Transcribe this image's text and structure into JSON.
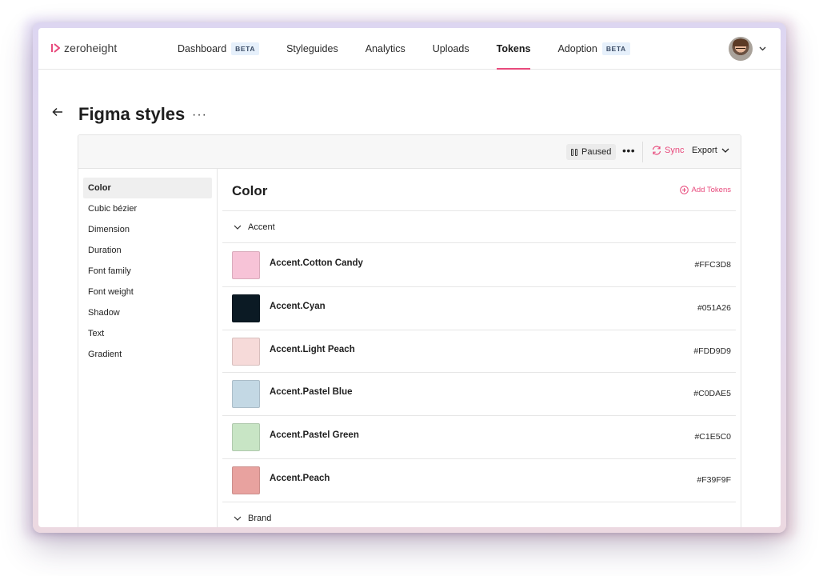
{
  "app": {
    "logo_text": "zeroheight",
    "brand_color": "#e84a7c"
  },
  "nav": {
    "items": [
      {
        "label": "Dashboard",
        "badge": "BETA",
        "active": false
      },
      {
        "label": "Styleguides",
        "badge": "",
        "active": false
      },
      {
        "label": "Analytics",
        "badge": "",
        "active": false
      },
      {
        "label": "Uploads",
        "badge": "",
        "active": false
      },
      {
        "label": "Tokens",
        "badge": "",
        "active": true
      },
      {
        "label": "Adoption",
        "badge": "BETA",
        "active": false
      }
    ],
    "avatar_icon": "user-avatar",
    "avatar_menu_icon": "chevron-down-icon"
  },
  "page": {
    "title": "Figma styles",
    "title_more": "···"
  },
  "toolbar": {
    "paused_label": "Paused",
    "more_label": "•••",
    "sync_label": "Sync",
    "export_label": "Export"
  },
  "sidebar": {
    "items": [
      {
        "label": "Color",
        "active": true
      },
      {
        "label": "Cubic bézier",
        "active": false
      },
      {
        "label": "Dimension",
        "active": false
      },
      {
        "label": "Duration",
        "active": false
      },
      {
        "label": "Font family",
        "active": false
      },
      {
        "label": "Font weight",
        "active": false
      },
      {
        "label": "Shadow",
        "active": false
      },
      {
        "label": "Text",
        "active": false
      },
      {
        "label": "Gradient",
        "active": false
      }
    ]
  },
  "main": {
    "title": "Color",
    "add_tokens_label": "Add Tokens",
    "groups": [
      {
        "name": "Accent",
        "tokens": [
          {
            "name": "Accent.Cotton Candy",
            "hex": "#FFC3D8",
            "swatch": "#F7C3D7"
          },
          {
            "name": "Accent.Cyan",
            "hex": "#051A26",
            "swatch": "#0B1A24"
          },
          {
            "name": "Accent.Light Peach",
            "hex": "#FDD9D9",
            "swatch": "#F6DAD9"
          },
          {
            "name": "Accent.Pastel Blue",
            "hex": "#C0DAE5",
            "swatch": "#C3D8E4"
          },
          {
            "name": "Accent.Pastel Green",
            "hex": "#C1E5C0",
            "swatch": "#C8E5C5"
          },
          {
            "name": "Accent.Peach",
            "hex": "#F39F9F",
            "swatch": "#E8A29F"
          }
        ]
      },
      {
        "name": "Brand",
        "tokens": []
      }
    ]
  }
}
